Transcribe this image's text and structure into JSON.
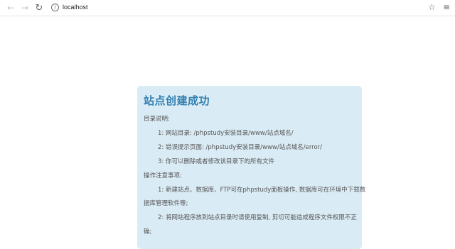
{
  "browser": {
    "back_icon": "←",
    "forward_icon": "→",
    "reload_icon": "↻",
    "info_icon": "i",
    "url": "localhost",
    "favorite_icon": "☆",
    "favorites_list_icon": "≡"
  },
  "card": {
    "title": "站点创建成功",
    "dir_heading": "目录说明:",
    "dir_items": [
      "1: 网站目录: /phpstudy安装目录/www/站点域名/",
      "2: 错误提示页面: /phpstudy安装目录/www/站点域名/error/",
      "3: 你可以删除或者修改该目录下的所有文件"
    ],
    "ops_heading": "操作注意事项:",
    "ops_items": [
      "1: 新建站点、数据库、FTP可在phpstudy面板操作, 数据库可在环境中下载数",
      "据库管理软件等;",
      "2: 将网站程序放到站点目录时请使用复制, 剪切可能造成程序文件权限不正",
      "确;"
    ]
  }
}
